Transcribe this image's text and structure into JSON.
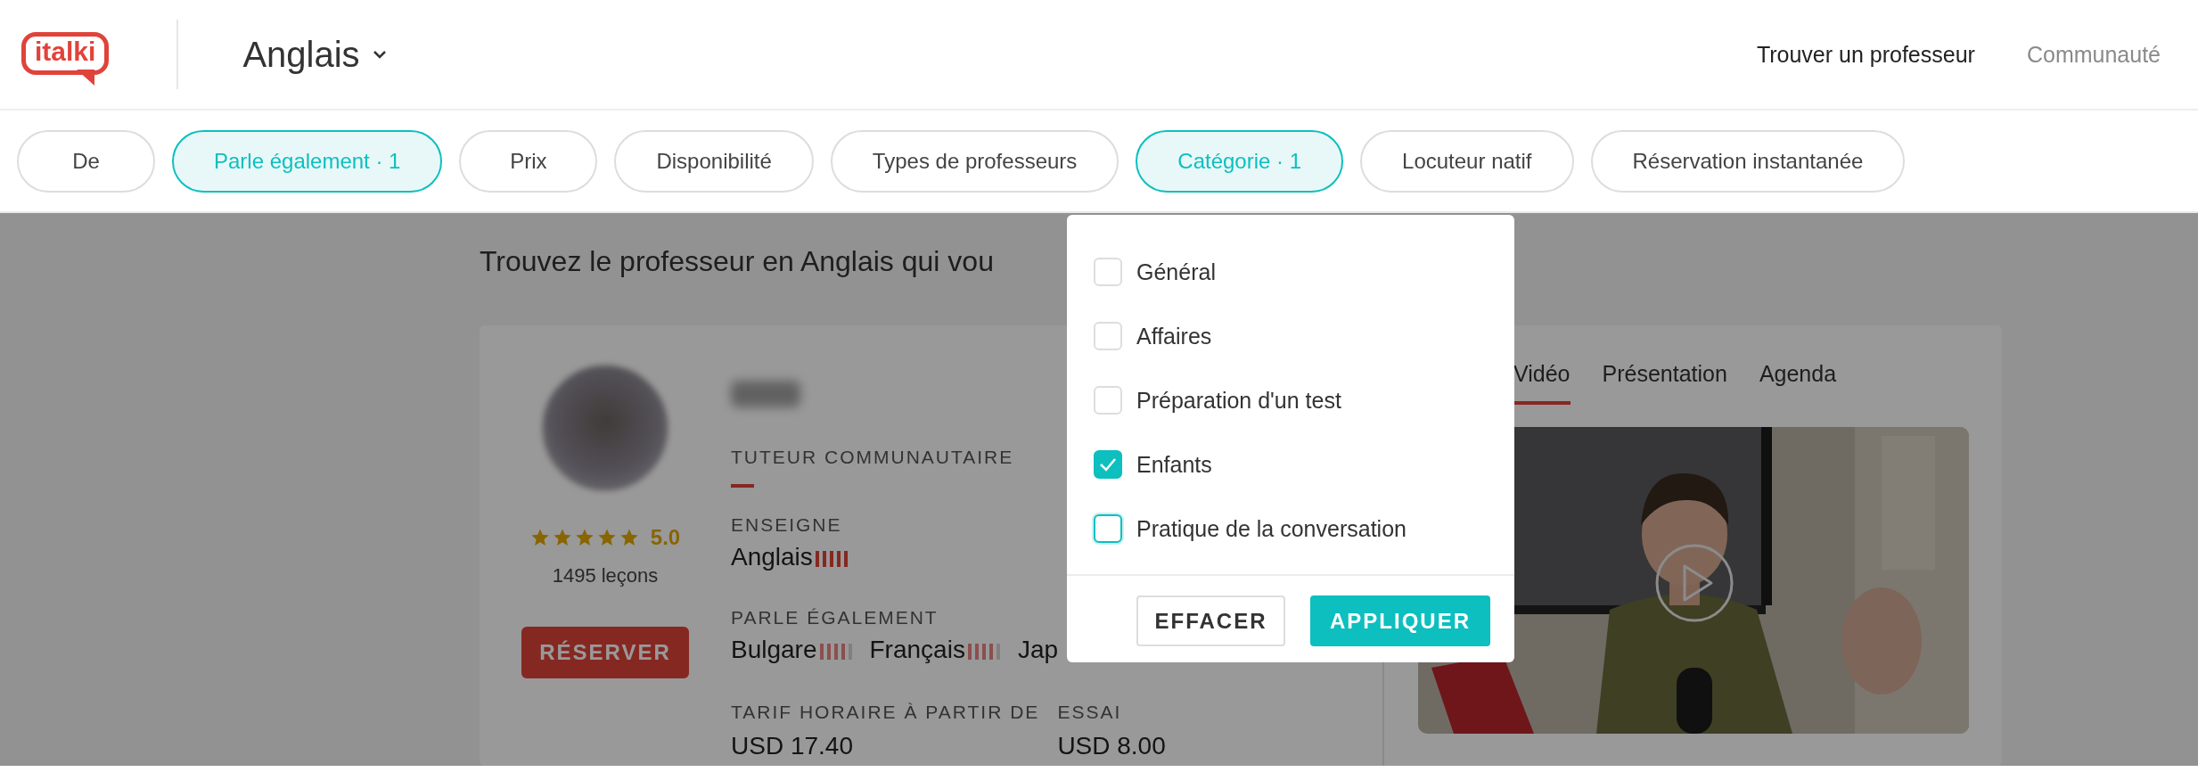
{
  "header": {
    "logo": "italki",
    "language": "Anglais",
    "nav": [
      {
        "label": "Trouver un professeur",
        "active": true
      },
      {
        "label": "Communauté",
        "active": false
      }
    ]
  },
  "filters": [
    {
      "label": "De",
      "selected": false
    },
    {
      "label": "Parle également · 1",
      "selected": true
    },
    {
      "label": "Prix",
      "selected": false
    },
    {
      "label": "Disponibilité",
      "selected": false
    },
    {
      "label": "Types de professeurs",
      "selected": false
    },
    {
      "label": "Catégorie · 1",
      "selected": true
    },
    {
      "label": "Locuteur natif",
      "selected": false
    },
    {
      "label": "Réservation instantanée",
      "selected": false
    }
  ],
  "heading": "Trouvez le professeur en Anglais qui vou",
  "teacher": {
    "stars": 5,
    "rating": "5.0",
    "lessons": "1495 leçons",
    "book_button": "RÉSERVER",
    "tutor_type": "TUTEUR COMMUNAUTAIRE",
    "teaches_label": "ENSEIGNE",
    "teaches": [
      {
        "language": "Anglais",
        "level": 1
      }
    ],
    "speaks_label": "PARLE ÉGALEMENT",
    "speaks": [
      {
        "language": "Bulgare",
        "level": 0.8
      },
      {
        "language": "Français",
        "level": 0.8
      },
      {
        "language": "Jap"
      }
    ],
    "rate_label": "TARIF HORAIRE À PARTIR DE",
    "rate": "USD 17.40",
    "trial_label": "ESSAI",
    "trial": "USD 8.00"
  },
  "media_tabs": [
    {
      "label": "Vidéo",
      "selected": true
    },
    {
      "label": "Présentation",
      "selected": false
    },
    {
      "label": "Agenda",
      "selected": false
    }
  ],
  "category_dropdown": {
    "options": [
      {
        "label": "Général",
        "checked": false,
        "hovered": false
      },
      {
        "label": "Affaires",
        "checked": false,
        "hovered": false
      },
      {
        "label": "Préparation d'un test",
        "checked": false,
        "hovered": false
      },
      {
        "label": "Enfants",
        "checked": true,
        "hovered": false
      },
      {
        "label": "Pratique de la conversation",
        "checked": false,
        "hovered": true
      }
    ],
    "clear_button": "EFFACER",
    "apply_button": "APPLIQUER"
  }
}
